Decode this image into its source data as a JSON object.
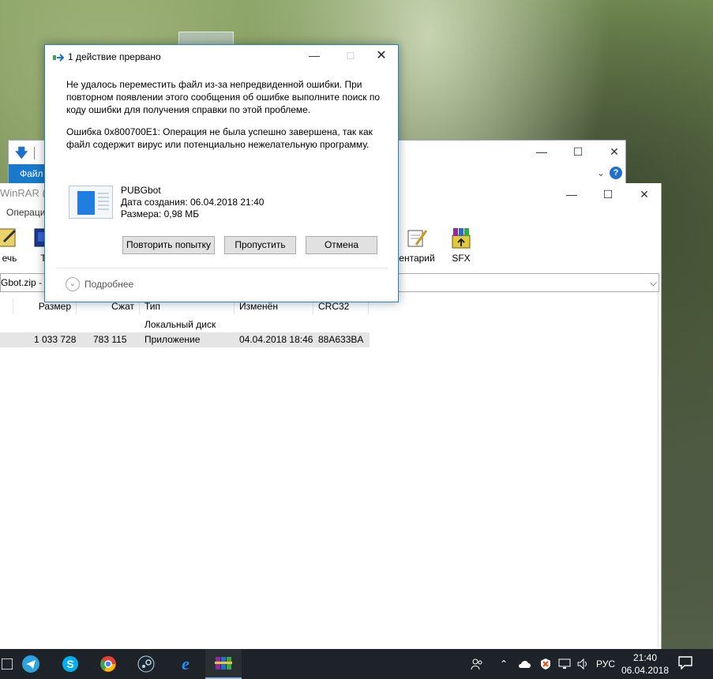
{
  "explorer": {
    "file_tab": "Файл",
    "minimize": "—",
    "maximize": "☐",
    "close": "✕",
    "help": "?"
  },
  "winrar": {
    "title": "WinRAR (п",
    "menu": "Операци",
    "toolbar": {
      "left_label": "ечь",
      "second_label": "T",
      "comment_label": "ентарий",
      "sfx_label": "SFX"
    },
    "address": "Gbot.zip - Z",
    "columns": [
      "Размер",
      "Сжат",
      "Тип",
      "Изменён",
      "CRC32"
    ],
    "rows": [
      {
        "size": "",
        "packed": "",
        "type": "Локальный диск",
        "modified": "",
        "crc": ""
      },
      {
        "size": "1 033 728",
        "packed": "783 115",
        "type": "Приложение",
        "modified": "04.04.2018 18:46",
        "crc": "88A633BA"
      }
    ]
  },
  "dialog": {
    "title": "1 действие прервано",
    "message": "Не удалось переместить файл из-за непредвиденной ошибки. При повторном появлении этого сообщения об ошибке выполните поиск по коду ошибки для получения справки по этой проблеме.",
    "error": "Ошибка 0x800700E1: Операция не была успешно завершена, так как файл содержит вирус или потенциально нежелательную программу.",
    "file_name": "PUBGbot",
    "file_created": "Дата создания: 06.04.2018 21:40",
    "file_size": "Размера: 0,98 МБ",
    "buttons": {
      "retry": "Повторить попытку",
      "skip": "Пропустить",
      "cancel": "Отмена"
    },
    "more": "Подробнее"
  },
  "taskbar": {
    "language": "РУС",
    "time": "21:40",
    "date": "06.04.2018",
    "apps": [
      "task-view-icon",
      "telegram-icon",
      "skype-icon",
      "chrome-icon",
      "steam-icon",
      "edge-icon",
      "winrar-icon"
    ]
  },
  "colors": {
    "accent": "#1883d7",
    "taskbar": "#1d2328",
    "file_tab": "#1979ca"
  }
}
